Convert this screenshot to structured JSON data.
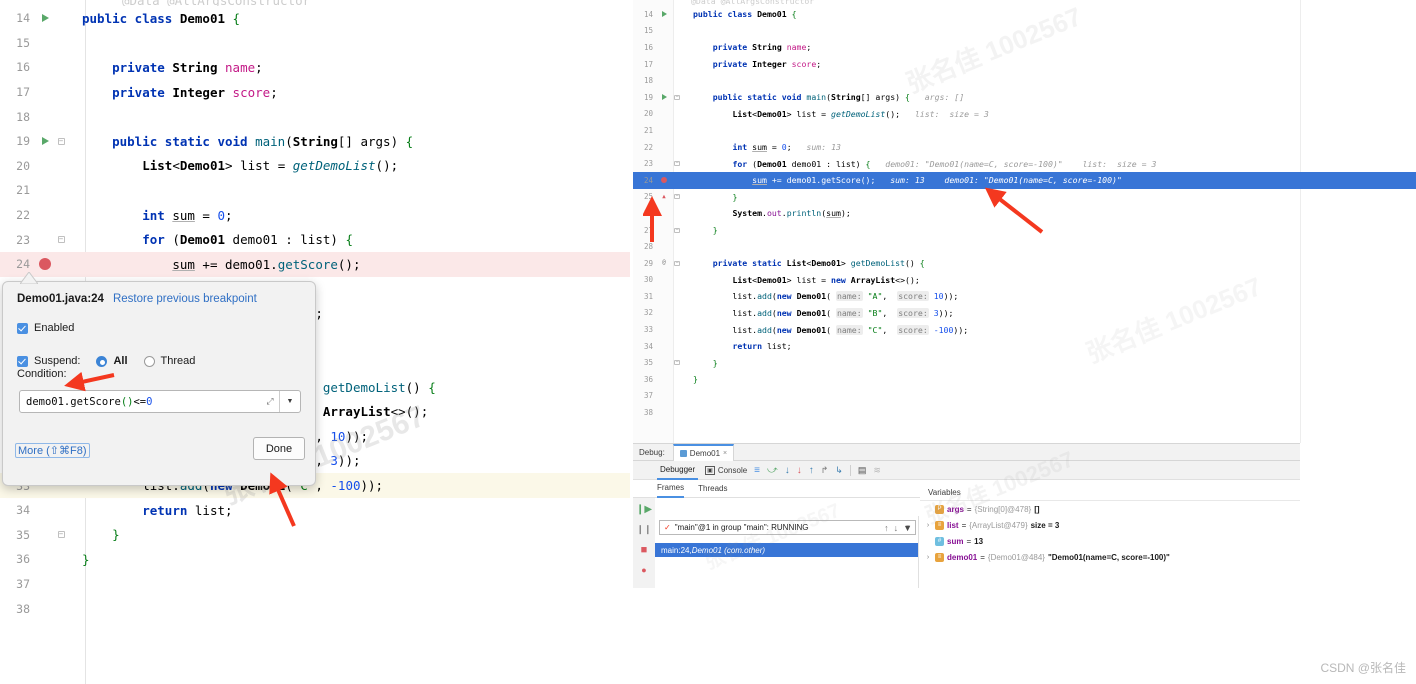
{
  "left_editor": {
    "name": "left-code-editor",
    "partial_top_line": "@Data @AllArgsConstructor",
    "lines": [
      {
        "num": "14",
        "marker": "run",
        "fold": "",
        "html": "<span class='kw'>public class</span> <span class='typ'>Demo01</span> <span class='brc'>{</span>"
      },
      {
        "num": "15",
        "marker": "",
        "fold": "",
        "html": ""
      },
      {
        "num": "16",
        "marker": "",
        "fold": "",
        "html": "    <span class='kw'>private</span> <span class='typ'>String</span> <span class='fld2'>name</span>;"
      },
      {
        "num": "17",
        "marker": "",
        "fold": "",
        "html": "    <span class='kw'>private</span> <span class='typ'>Integer</span> <span class='fld2'>score</span>;"
      },
      {
        "num": "18",
        "marker": "",
        "fold": "",
        "html": ""
      },
      {
        "num": "19",
        "marker": "run",
        "fold": "minus",
        "html": "    <span class='kw'>public static void</span> <span class='mth'>main</span>(<span class='typ'>String</span>[] args) <span class='brc'>{</span>"
      },
      {
        "num": "20",
        "marker": "",
        "fold": "",
        "html": "        <span class='typ'>List</span>&lt;<span class='typ'>Demo01</span>&gt; list = <span class='mthi'>getDemoList</span>();"
      },
      {
        "num": "21",
        "marker": "",
        "fold": "",
        "html": ""
      },
      {
        "num": "22",
        "marker": "",
        "fold": "",
        "html": "        <span class='kw'>int</span> <span class='und'>sum</span> = <span class='num'>0</span>;"
      },
      {
        "num": "23",
        "marker": "",
        "fold": "minus",
        "html": "        <span class='kw'>for</span> (<span class='typ'>Demo01</span> demo01 : list) <span class='brc'>{</span>"
      },
      {
        "num": "24",
        "marker": "breakpoint",
        "fold": "",
        "highlight": "red",
        "html": "            <span class='und'>sum</span> += demo01.<span class='mth'>getScore</span>();"
      },
      {
        "num": "25",
        "marker": "",
        "fold": "",
        "html": "        <span class='brc'>}</span>"
      },
      {
        "num": "26",
        "marker": "",
        "fold": "",
        "html": "        <span class='typ'>System</span>.<span class='fld'>out</span>.<span class='mth'>println</span>(<span class='und'>sum</span>);"
      },
      {
        "num": "27",
        "marker": "",
        "fold": "",
        "html": "    <span class='brc'>}</span>"
      },
      {
        "num": "28",
        "marker": "",
        "fold": "",
        "html": ""
      },
      {
        "num": "29",
        "marker": "at",
        "fold": "minus",
        "html": "    <span class='kw'>private static</span> <span class='typ'>List</span>&lt;<span class='typ'>Demo01</span>&gt; <span class='mth'>getDemoList</span>() <span class='brc'>{</span>"
      },
      {
        "num": "30",
        "marker": "",
        "fold": "",
        "html": "        <span class='typ'>List</span>&lt;<span class='typ'>Demo01</span>&gt; list = <span class='kw'>new</span> <span class='typ'>ArrayList</span>&lt;&gt;();"
      },
      {
        "num": "31",
        "marker": "",
        "fold": "",
        "html": "        list.<span class='mth'>add</span>(<span class='kw'>new</span> <span class='typ'>Demo01</span>(<span class='str'>\"A\"</span>, <span class='num'>10</span>));"
      },
      {
        "num": "32",
        "marker": "",
        "fold": "",
        "html": "        list.<span class='mth'>add</span>(<span class='kw'>new</span> <span class='typ'>Demo01</span>(<span class='str'>\"B\"</span>, <span class='num'>3</span>));"
      },
      {
        "num": "33",
        "marker": "",
        "fold": "",
        "highlight": "yellow",
        "html": "        list.<span class='mth'>add</span>(<span class='kw'>new</span> <span class='typ'>Demo01</span>(<span class='str'>\"C\"</span>, <span class='num'>-100</span>));"
      },
      {
        "num": "34",
        "marker": "",
        "fold": "",
        "html": "        <span class='kw'>return</span> list;"
      },
      {
        "num": "35",
        "marker": "",
        "fold": "minus",
        "html": "    <span class='brc'>}</span>"
      },
      {
        "num": "36",
        "marker": "",
        "fold": "",
        "html": "<span class='brc'>}</span>"
      },
      {
        "num": "37",
        "marker": "",
        "fold": "",
        "html": ""
      },
      {
        "num": "38",
        "marker": "",
        "fold": "",
        "html": ""
      }
    ]
  },
  "right_editor": {
    "name": "right-code-editor",
    "partial_top_line": "@Data @AllArgsConstructor",
    "lines": [
      {
        "num": "14",
        "marker": "run",
        "fold": "",
        "html": "<span class='kw'>public class</span> <span class='typ'>Demo01</span> <span class='brc'>{</span>"
      },
      {
        "num": "15",
        "marker": "",
        "fold": "",
        "html": ""
      },
      {
        "num": "16",
        "marker": "",
        "fold": "",
        "html": "    <span class='kw'>private</span> <span class='typ'>String</span> <span class='fld2'>name</span>;"
      },
      {
        "num": "17",
        "marker": "",
        "fold": "",
        "html": "    <span class='kw'>private</span> <span class='typ'>Integer</span> <span class='fld2'>score</span>;"
      },
      {
        "num": "18",
        "marker": "",
        "fold": "",
        "html": ""
      },
      {
        "num": "19",
        "marker": "run",
        "fold": "minus",
        "html": "    <span class='kw'>public static void</span> <span class='mth'>main</span>(<span class='typ'>String</span>[] args) <span class='brc'>{</span>   <span class='inlineval'>args: []</span>"
      },
      {
        "num": "20",
        "marker": "",
        "fold": "",
        "html": "        <span class='typ'>List</span>&lt;<span class='typ'>Demo01</span>&gt; list = <span class='mthi'>getDemoList</span>();   <span class='inlineval'>list:  size = 3</span>"
      },
      {
        "num": "21",
        "marker": "",
        "fold": "",
        "html": ""
      },
      {
        "num": "22",
        "marker": "",
        "fold": "",
        "html": "        <span class='kw'>int</span> <span class='und'>sum</span> = <span class='num'>0</span>;   <span class='inlineval'>sum: 13</span>"
      },
      {
        "num": "23",
        "marker": "",
        "fold": "minus",
        "html": "        <span class='kw'>for</span> (<span class='typ'>Demo01</span> demo01 : list) <span class='brc'>{</span>   <span class='inlineval'>demo01: \"Demo01(name=C, score=-100)\"    list:  size = 3</span>"
      },
      {
        "num": "24",
        "marker": "breakpoint-cond",
        "fold": "",
        "highlight": "blue",
        "html": "            <span class='und'>sum</span> += demo01.<span class='mth'>getScore</span>();   <span class='inlineval'>sum: 13    demo01: \"Demo01(name=C, score=-100)\"</span>"
      },
      {
        "num": "25",
        "marker": "drop",
        "fold": "minus",
        "html": "        <span class='brc'>}</span>"
      },
      {
        "num": "26",
        "marker": "",
        "fold": "",
        "html": "        <span class='typ'>System</span>.<span class='fld'>out</span>.<span class='mth'>println</span>(<span class='und'>sum</span>);"
      },
      {
        "num": "27",
        "marker": "",
        "fold": "minus",
        "html": "    <span class='brc'>}</span>"
      },
      {
        "num": "28",
        "marker": "",
        "fold": "",
        "html": ""
      },
      {
        "num": "29",
        "marker": "at",
        "fold": "minus",
        "html": "    <span class='kw'>private static</span> <span class='typ'>List</span>&lt;<span class='typ'>Demo01</span>&gt; <span class='mth'>getDemoList</span>() <span class='brc'>{</span>"
      },
      {
        "num": "30",
        "marker": "",
        "fold": "",
        "html": "        <span class='typ'>List</span>&lt;<span class='typ'>Demo01</span>&gt; list = <span class='kw'>new</span> <span class='typ'>ArrayList</span>&lt;&gt;();"
      },
      {
        "num": "31",
        "marker": "",
        "fold": "",
        "html": "        list.<span class='mth'>add</span>(<span class='kw'>new</span> <span class='typ'>Demo01</span>( <span class='paramhint'>name:</span> <span class='str'>\"A\"</span>,  <span class='paramhint'>score:</span> <span class='num'>10</span>));"
      },
      {
        "num": "32",
        "marker": "",
        "fold": "",
        "html": "        list.<span class='mth'>add</span>(<span class='kw'>new</span> <span class='typ'>Demo01</span>( <span class='paramhint'>name:</span> <span class='str'>\"B\"</span>,  <span class='paramhint'>score:</span> <span class='num'>3</span>));"
      },
      {
        "num": "33",
        "marker": "",
        "fold": "",
        "html": "        list.<span class='mth'>add</span>(<span class='kw'>new</span> <span class='typ'>Demo01</span>( <span class='paramhint'>name:</span> <span class='str'>\"C\"</span>,  <span class='paramhint'>score:</span> <span class='num'>-100</span>));"
      },
      {
        "num": "34",
        "marker": "",
        "fold": "",
        "html": "        <span class='kw'>return</span> list;"
      },
      {
        "num": "35",
        "marker": "",
        "fold": "minus",
        "html": "    <span class='brc'>}</span>"
      },
      {
        "num": "36",
        "marker": "",
        "fold": "",
        "html": "<span class='brc'>}</span>"
      },
      {
        "num": "37",
        "marker": "",
        "fold": "",
        "html": ""
      },
      {
        "num": "38",
        "marker": "",
        "fold": "",
        "html": ""
      }
    ]
  },
  "breakpoint_popup": {
    "file_line": "Demo01.java:24",
    "restore_link": "Restore previous breakpoint",
    "enabled_label": "Enabled",
    "enabled_checked": true,
    "suspend_label": "Suspend:",
    "suspend_checked": true,
    "suspend_all": "All",
    "suspend_thread": "Thread",
    "suspend_selected": "All",
    "condition_label": "Condition:",
    "condition_value": "demo01.getScore()<=0",
    "more_label": "More (⇧⌘F8)",
    "done_label": "Done",
    "accent": "#4a90e2"
  },
  "debug_window": {
    "title": "Debug:",
    "tab_name": "Demo01",
    "tab_close": "×",
    "toolbar": {
      "debugger_tab": "Debugger",
      "console_tab": "Console",
      "buttons": [
        "layout-icon",
        "step-over-icon",
        "step-into-icon",
        "force-step-into-icon",
        "step-out-icon",
        "drop-frame-icon",
        "run-to-cursor-icon",
        "evaluate-expression-icon",
        "mute-breakpoints-icon"
      ]
    },
    "subtabs": {
      "frames": "Frames",
      "threads": "Threads",
      "active": "Frames"
    },
    "left_rail": [
      "rerun-icon",
      "settings-wrench-icon",
      "resume-program-icon",
      "pause-program-icon",
      "stop-icon",
      "view-breakpoints-icon"
    ],
    "frames": {
      "thread_selector": "\"main\"@1 in group \"main\": RUNNING",
      "thread_status_check": "✓",
      "controls": [
        "up-arrow-icon",
        "down-arrow-icon",
        "filter-icon"
      ],
      "rows": [
        {
          "location": "main:24, ",
          "detail": "Demo01 (com.other)"
        }
      ]
    },
    "variables": {
      "header": "Variables",
      "rows": [
        {
          "expandable": false,
          "icon_color": "#e8a33d",
          "icon_letter": "P",
          "name": "args",
          "ref": "{String[0]@478}",
          "value": "[]"
        },
        {
          "expandable": true,
          "icon_color": "#e8a33d",
          "icon_letter": "≡",
          "name": "list",
          "ref": "{ArrayList@479}",
          "value": "size = 3"
        },
        {
          "expandable": false,
          "icon_color": "#6fbfe0",
          "icon_letter": "#",
          "name": "sum",
          "ref": "",
          "value": "13"
        },
        {
          "expandable": true,
          "icon_color": "#e8a33d",
          "icon_letter": "≡",
          "name": "demo01",
          "ref": "{Demo01@484}",
          "value": "\"Demo01(name=C, score=-100)\""
        }
      ]
    }
  },
  "annotations": {
    "arrow_color": "#f4381f",
    "arrows": [
      {
        "name": "arrow-to-condition-label"
      },
      {
        "name": "arrow-to-done-button"
      },
      {
        "name": "arrow-to-line-25-gutter"
      },
      {
        "name": "arrow-to-inline-value"
      }
    ]
  },
  "watermarks": {
    "diagonal_text": "张名佳 1002567",
    "csdn": "CSDN @张名佳"
  }
}
